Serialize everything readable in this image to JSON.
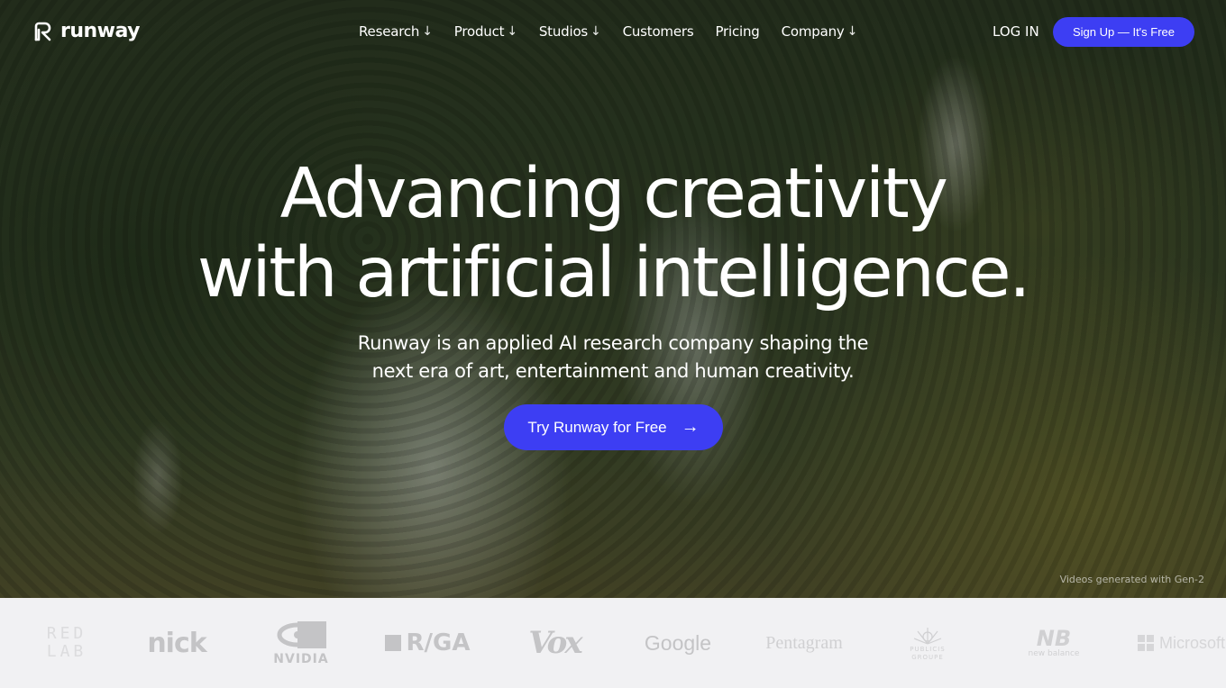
{
  "brand": {
    "name": "runway",
    "accent_color": "#3d3ef3"
  },
  "nav": {
    "items": [
      {
        "label": "Research",
        "has_dropdown": true,
        "icon": "arrow-down-icon"
      },
      {
        "label": "Product",
        "has_dropdown": true,
        "icon": "arrow-down-icon"
      },
      {
        "label": "Studios",
        "has_dropdown": true,
        "icon": "arrow-down-icon"
      },
      {
        "label": "Customers",
        "has_dropdown": false
      },
      {
        "label": "Pricing",
        "has_dropdown": false
      },
      {
        "label": "Company",
        "has_dropdown": true,
        "icon": "arrow-down-icon"
      }
    ],
    "dropdown_arrow": "↓",
    "login_label": "LOG IN",
    "signup_label": "Sign Up — It's Free"
  },
  "hero": {
    "headline_line1": "Advancing creativity",
    "headline_line2": "with artificial intelligence.",
    "subtitle_line1": "Runway is an applied AI research company shaping the",
    "subtitle_line2": "next era of art, entertainment and human creativity.",
    "cta_label": "Try Runway for Free",
    "cta_arrow": "→",
    "credit": "Videos generated with Gen-2"
  },
  "logos": {
    "redlab": {
      "line1": "RED",
      "line2": "LAB"
    },
    "nick": "nick",
    "nvidia": "NVIDIA",
    "rga": "R/GA",
    "vox": "Vox",
    "google": "Google",
    "pentagram": "Pentagram",
    "publicis": {
      "line1": "PUBLICIS",
      "line2": "GROUPE"
    },
    "newbalance": {
      "mark": "NB",
      "text": "new balance"
    },
    "microsoft": "Microsoft"
  }
}
